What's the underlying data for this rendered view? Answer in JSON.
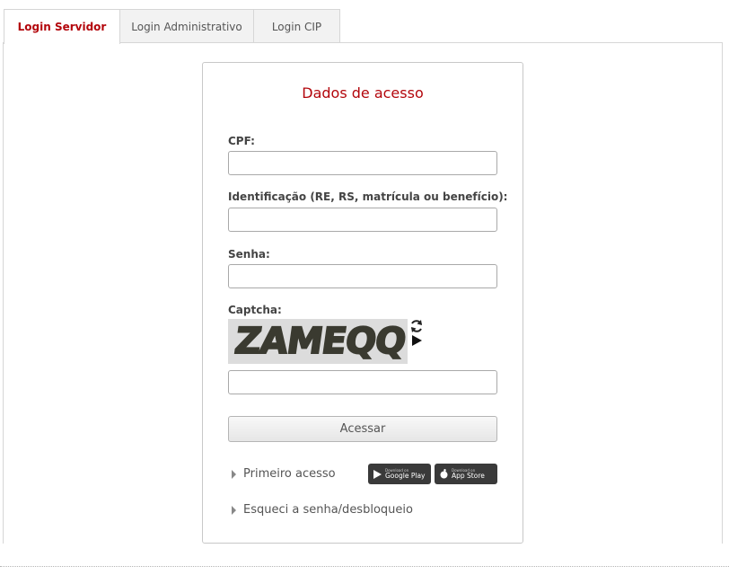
{
  "tabs": [
    {
      "label": "Login Servidor",
      "active": true
    },
    {
      "label": "Login Administrativo",
      "active": false
    },
    {
      "label": "Login CIP",
      "active": false
    }
  ],
  "card": {
    "title": "Dados de acesso"
  },
  "form": {
    "cpf_label": "CPF:",
    "cpf_value": "",
    "id_label": "Identificação (RE, RS, matrícula ou benefício):",
    "id_value": "",
    "senha_label": "Senha:",
    "senha_value": "",
    "captcha_label": "Captcha:",
    "captcha_text": "ZAMEQQ",
    "captcha_value": "",
    "submit_label": "Acessar"
  },
  "links": {
    "first_access": "Primeiro acesso",
    "forgot": "Esqueci a senha/desbloqueio"
  },
  "stores": {
    "google_small": "Download on",
    "google_big": "Google Play",
    "apple_small": "Download on",
    "apple_big": "App Store"
  },
  "colors": {
    "accent": "#b3060c",
    "store_bg": "#3a3a3a"
  }
}
